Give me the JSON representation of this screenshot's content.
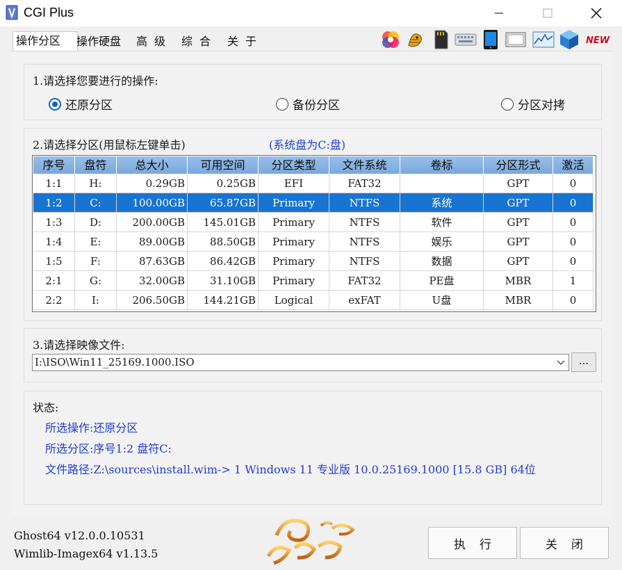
{
  "window": {
    "title": "CGI Plus"
  },
  "tabs": [
    {
      "label": "操作分区"
    },
    {
      "label": "操作硬盘"
    },
    {
      "label": "高级"
    },
    {
      "label": "综合"
    },
    {
      "label": "关于"
    }
  ],
  "step1": {
    "label": "1.请选择您要进行的操作:",
    "options": [
      "还原分区",
      "备份分区",
      "分区对拷"
    ],
    "selected": "还原分区"
  },
  "step2": {
    "label": "2.请选择分区(用鼠标左键单击)",
    "system_note": "(系统盘为C:盘)",
    "columns": [
      "序号",
      "盘符",
      "总大小",
      "可用空间",
      "分区类型",
      "文件系统",
      "卷标",
      "分区形式",
      "激活"
    ],
    "rows": [
      [
        "1:1",
        "H:",
        "0.29GB",
        "0.25GB",
        "EFI",
        "FAT32",
        "",
        "GPT",
        "0"
      ],
      [
        "1:2",
        "C:",
        "100.00GB",
        "65.87GB",
        "Primary",
        "NTFS",
        "系统",
        "GPT",
        "0"
      ],
      [
        "1:3",
        "D:",
        "200.00GB",
        "145.01GB",
        "Primary",
        "NTFS",
        "软件",
        "GPT",
        "0"
      ],
      [
        "1:4",
        "E:",
        "89.00GB",
        "88.50GB",
        "Primary",
        "NTFS",
        "娱乐",
        "GPT",
        "0"
      ],
      [
        "1:5",
        "F:",
        "87.63GB",
        "86.42GB",
        "Primary",
        "NTFS",
        "数据",
        "GPT",
        "0"
      ],
      [
        "2:1",
        "G:",
        "32.00GB",
        "31.10GB",
        "Primary",
        "FAT32",
        "PE盘",
        "MBR",
        "1"
      ],
      [
        "2:2",
        "I:",
        "206.50GB",
        "144.21GB",
        "Logical",
        "exFAT",
        "U盘",
        "MBR",
        "0"
      ]
    ],
    "selected_row": 1
  },
  "step3": {
    "label": "3.请选择映像文件:",
    "image_path": "I:\\ISO\\Win11_25169.1000.ISO",
    "browse_label": "..."
  },
  "status": {
    "label": "状态:",
    "lines": [
      "所选操作:还原分区",
      "所选分区:序号1:2 盘符C:",
      "文件路径:Z:\\sources\\install.wim-> 1 Windows 11 专业版 10.0.25169.1000 [15.8 GB] 64位"
    ]
  },
  "footer": {
    "ghost_version": "Ghost64 v12.0.0.10531",
    "wimlib_version": "Wimlib-Imagex64 v1.13.5",
    "execute_label": "执行",
    "close_label": "关闭"
  },
  "toolbar_icons": [
    "color-wheel-icon",
    "tiger-icon",
    "sd-card-icon",
    "keyboard-icon",
    "tablet-icon",
    "monitor-icon",
    "performance-chart-icon",
    "cube-icon",
    "new-badge-icon"
  ],
  "colors": {
    "selection": "#1874d2",
    "header": "#89b5e4",
    "status_text": "#1f3ed0",
    "radio_accent": "#1565c0"
  }
}
